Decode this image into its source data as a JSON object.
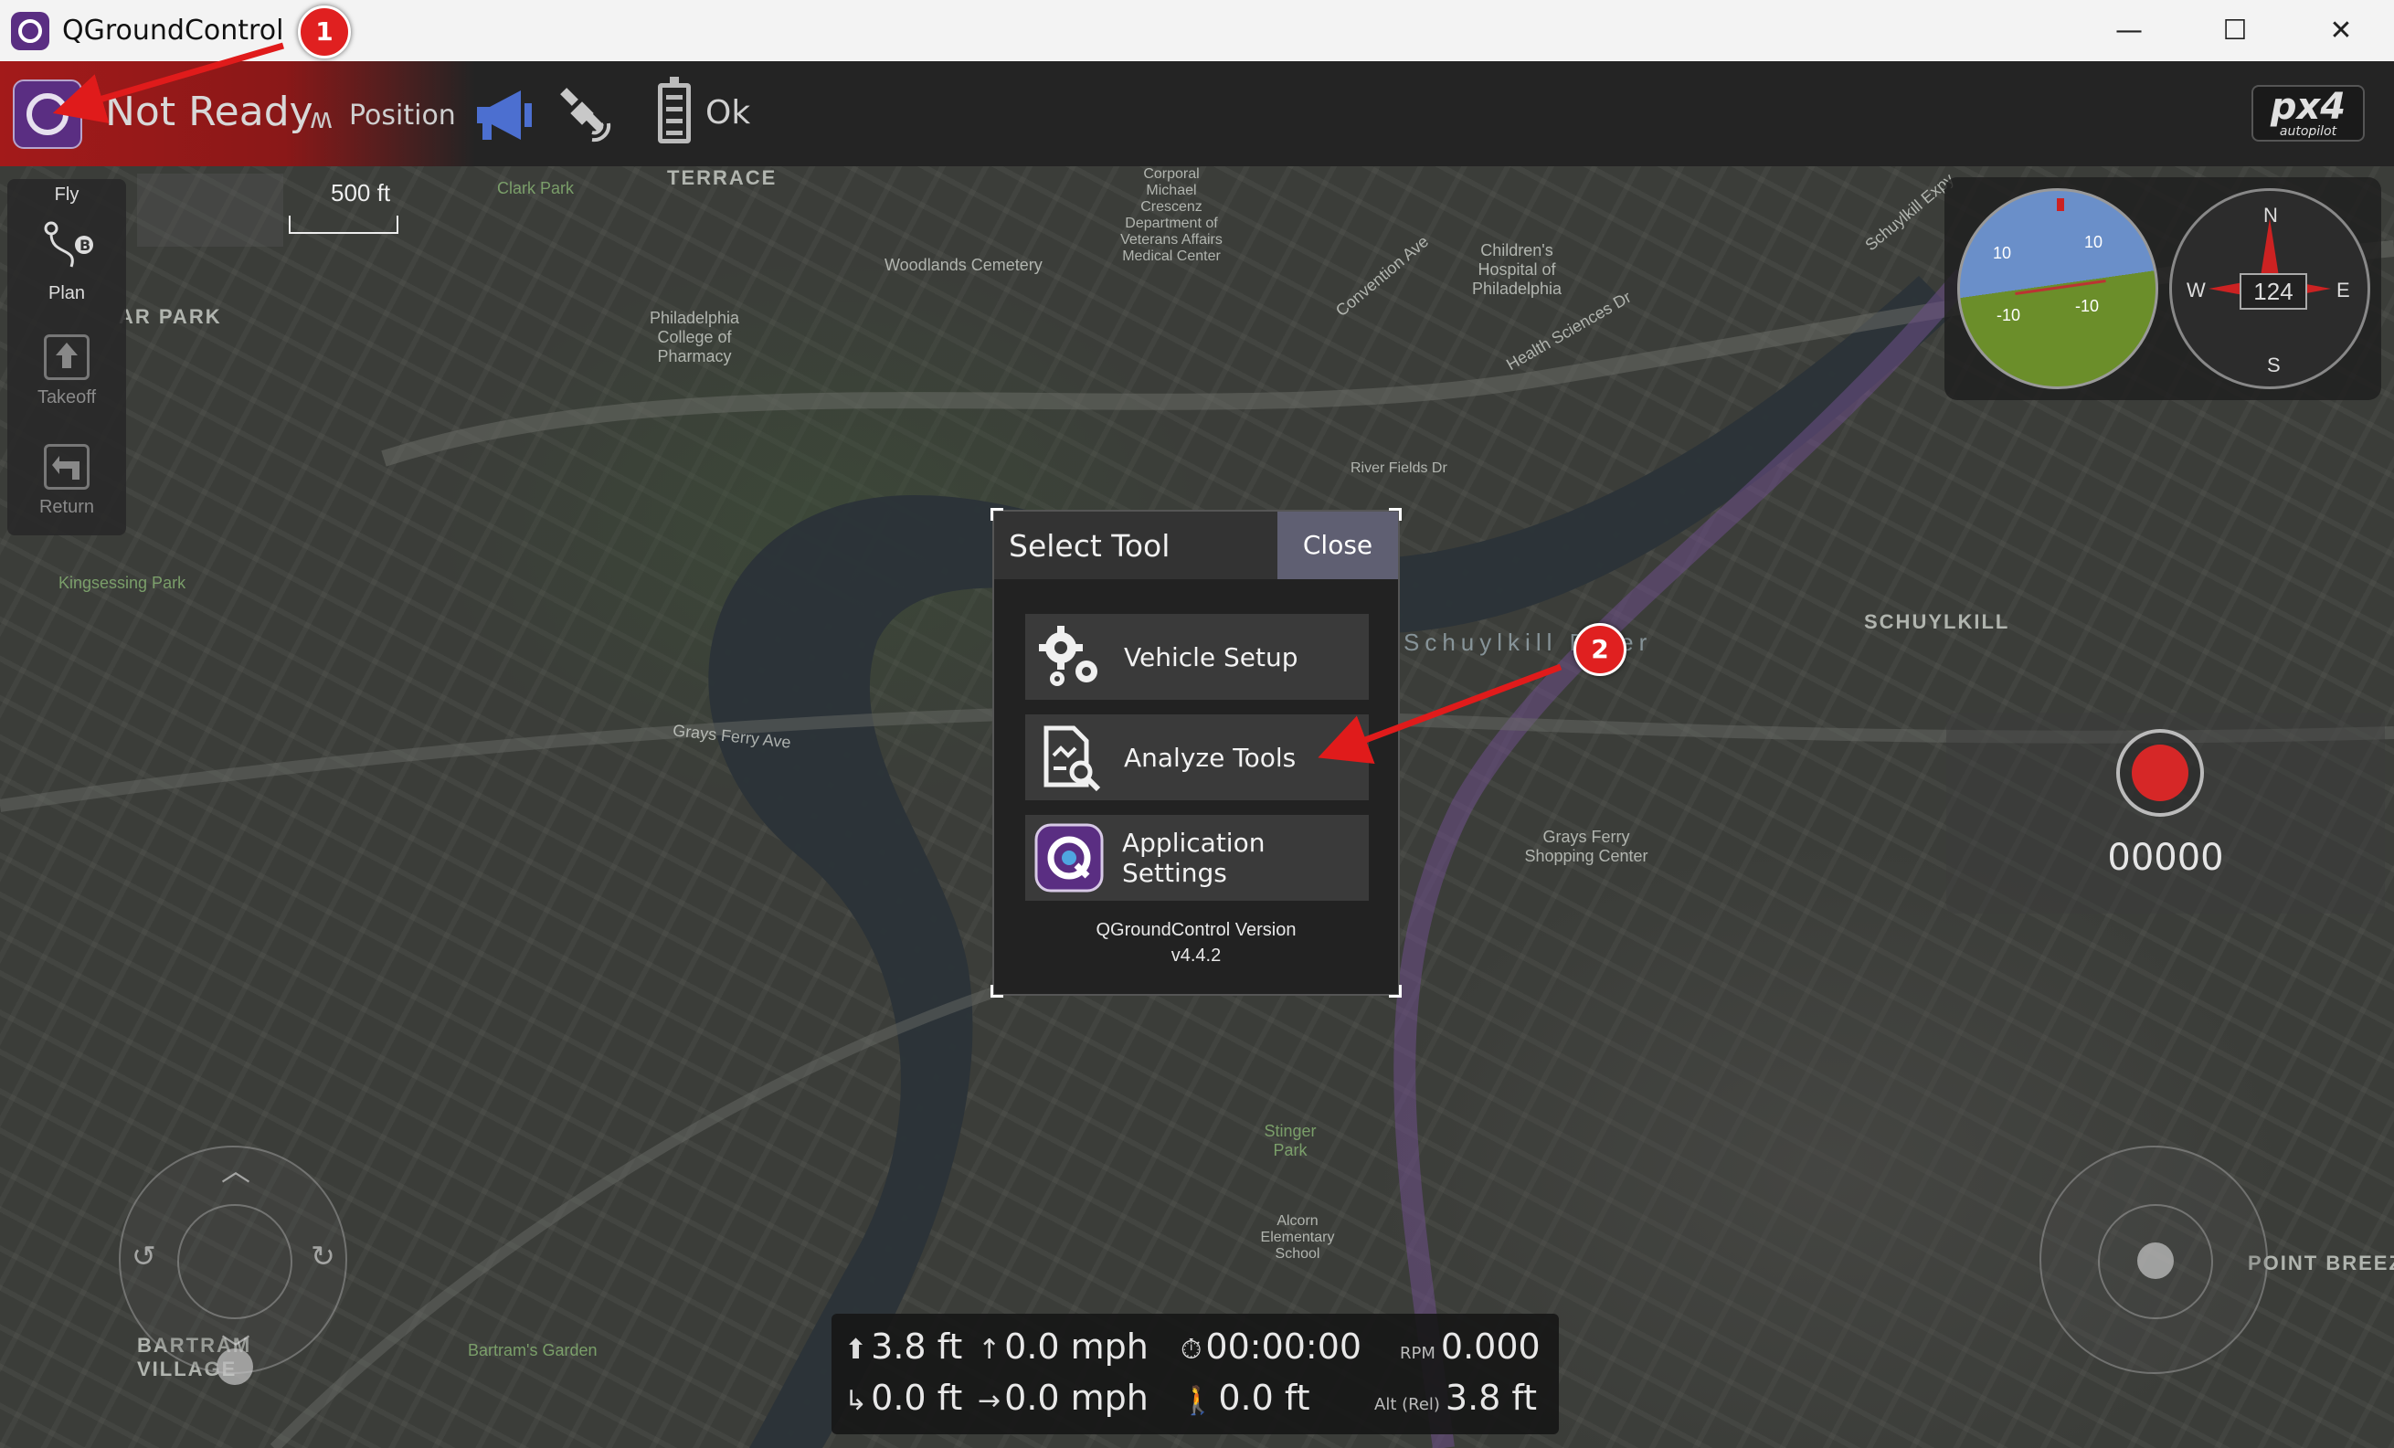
{
  "window": {
    "title": "QGroundControl",
    "minimize": "—",
    "maximize": "☐",
    "close": "✕"
  },
  "toolbar": {
    "status": "Not Ready",
    "flight_mode": "Position",
    "battery": "Ok",
    "logo_main": "px4",
    "logo_sub": "autopilot"
  },
  "flytools": {
    "title": "Fly",
    "items": [
      {
        "label": "Plan",
        "icon": "plan-icon"
      },
      {
        "label": "Takeoff",
        "icon": "takeoff-icon"
      },
      {
        "label": "Return",
        "icon": "return-icon"
      }
    ]
  },
  "map": {
    "scale": "500 ft",
    "labels": {
      "terrace": "TERRACE",
      "clark_park": "Clark Park",
      "woodlands": "Woodlands Cemetery",
      "ar_park": "AR PARK",
      "phil_college": "Philadelphia College of Pharmacy",
      "veterans": "Corporal Michael Crescenz Department of Veterans Affairs Medical Center",
      "childrens": "Children's Hospital of Philadelphia",
      "kingsessing": "Kingsessing Park",
      "schuylkill_river": "Schuylkill River",
      "schuylkill_area": "SCHUYLKILL",
      "grays_ferry": "Grays Ferry Ave",
      "grays_ferry_center": "Grays Ferry Shopping Center",
      "bartram_village": "BARTRAM VILLAGE",
      "bartrams_garden": "Bartram's Garden",
      "point_breeze": "POINT BREEZE",
      "stinger_park": "Stinger Park",
      "alcorn": "Alcorn Elementary School",
      "river_fields": "River Fields Dr",
      "schuylkill_expy": "Schuylkill Expy",
      "convention_ave": "Convention Ave",
      "health_sciences": "Health Sciences Dr"
    }
  },
  "instruments": {
    "heading": "124",
    "compass_n": "N",
    "compass_s": "S",
    "compass_e": "E",
    "compass_w": "W",
    "pitch_pos": "10",
    "pitch_neg": "-10"
  },
  "record": {
    "counter": "00000"
  },
  "telemetry": {
    "altitude": "3.8 ft",
    "vertical_speed": "0.0 mph",
    "flight_time": "00:00:00",
    "rpm_label": "RPM",
    "rpm": "0.000",
    "distance": "0.0 ft",
    "horizontal_speed": "0.0 mph",
    "home_distance": "0.0 ft",
    "alt_rel_label": "Alt (Rel)",
    "alt_rel": "3.8 ft"
  },
  "dialog": {
    "title": "Select Tool",
    "close": "Close",
    "buttons": [
      {
        "label": "Vehicle Setup",
        "icon": "gears-icon"
      },
      {
        "label": "Analyze Tools",
        "icon": "analyze-icon"
      },
      {
        "label": "Application Settings",
        "icon": "qgc-logo-icon"
      }
    ],
    "version_line1": "QGroundControl Version",
    "version_line2": "v4.4.2"
  },
  "annotations": {
    "badge1": "1",
    "badge2": "2",
    "arrow_color": "#e01b1b"
  }
}
